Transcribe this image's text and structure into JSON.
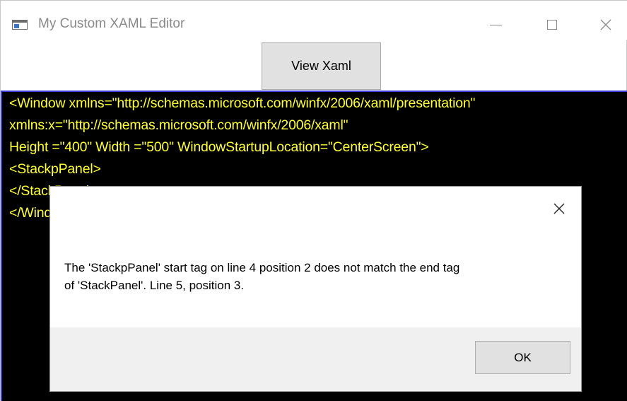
{
  "window": {
    "title": "My Custom XAML Editor"
  },
  "toolbar": {
    "view_xaml_label": "View Xaml"
  },
  "editor": {
    "lines": [
      "<Window xmlns=\"http://schemas.microsoft.com/winfx/2006/xaml/presentation\"",
      "xmlns:x=\"http://schemas.microsoft.com/winfx/2006/xaml\"",
      "Height =\"400\" Width =\"500\" WindowStartupLocation=\"CenterScreen\">",
      "<StackpPanel>",
      "</StackPanel>",
      "</Window>"
    ],
    "text_color": "#ffff33",
    "background_color": "#000000"
  },
  "dialog": {
    "message_line1": "The 'StackpPanel' start tag on line 4 position 2 does not match the end tag",
    "message_line2": "of 'StackPanel'. Line 5, position 3.",
    "ok_label": "OK"
  },
  "icons": {
    "app": "window-app-icon",
    "minimize": "minimize-icon",
    "maximize": "maximize-icon",
    "close": "close-icon",
    "dialog_close": "close-icon"
  }
}
